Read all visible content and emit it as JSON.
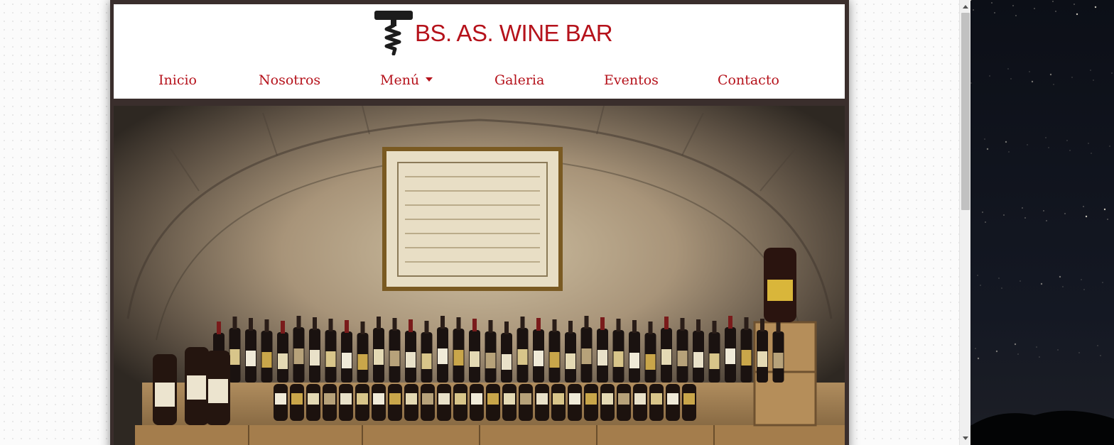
{
  "site": {
    "brand": "BS. AS. WINE BAR",
    "brand_color": "#b5121b"
  },
  "nav": {
    "items": [
      {
        "label": "Inicio"
      },
      {
        "label": "Nosotros"
      },
      {
        "label": "Menú",
        "dropdown": true
      },
      {
        "label": "Galeria"
      },
      {
        "label": "Eventos"
      },
      {
        "label": "Contacto"
      }
    ]
  },
  "icons": {
    "logo": "corkscrew-icon",
    "dropdown": "caret-down-icon",
    "scroll_up": "scroll-up-arrow-icon",
    "scroll_down": "scroll-down-arrow-icon"
  },
  "hero": {
    "subject": "wine-cellar-photo"
  },
  "colors": {
    "frame": "#3a2e2c",
    "page_bg": "#fbfbfb"
  }
}
